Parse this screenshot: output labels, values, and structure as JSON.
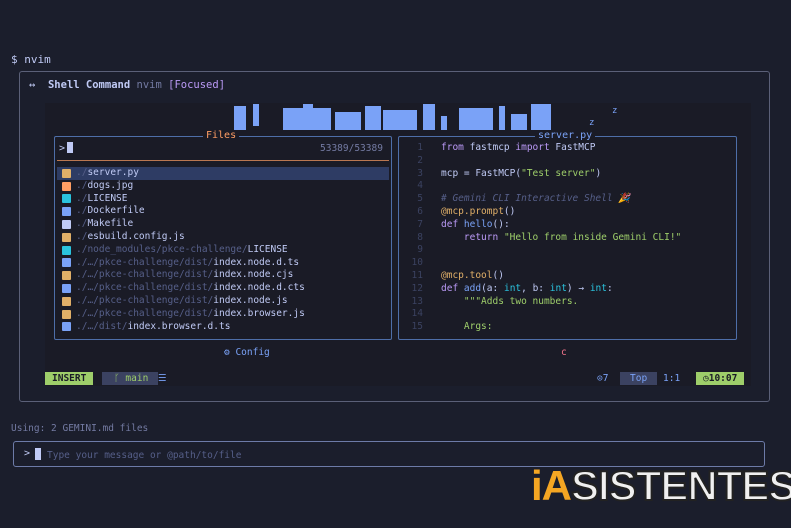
{
  "shell": {
    "prompt": "$ nvim"
  },
  "panel": {
    "arrows": "↔",
    "title": "Shell Command",
    "command": "nvim",
    "state": "[Focused]"
  },
  "logo": {
    "zz": "z z"
  },
  "files": {
    "title": "Files",
    "input_symbol": ">",
    "count": "53389/53389",
    "items": [
      {
        "dim": "./",
        "name": "server.py",
        "icon_color": "#e0af68",
        "selected": true
      },
      {
        "dim": "./",
        "name": "dogs.jpg",
        "icon_color": "#ff9e64",
        "selected": false
      },
      {
        "dim": "./",
        "name": "LICENSE",
        "icon_color": "#2ac3de",
        "selected": false
      },
      {
        "dim": "./",
        "name": "Dockerfile",
        "icon_color": "#7aa2f7",
        "selected": false
      },
      {
        "dim": "./",
        "name": "Makefile",
        "icon_color": "#c0caf5",
        "selected": false
      },
      {
        "dim": "./",
        "name": "esbuild.config.js",
        "icon_color": "#e0af68",
        "selected": false
      },
      {
        "dim": "./node_modules/pkce-challenge/",
        "name": "LICENSE",
        "icon_color": "#2ac3de",
        "selected": false
      },
      {
        "dim": "./…/pkce-challenge/dist/",
        "name": "index.node.d.ts",
        "icon_color": "#7aa2f7",
        "selected": false
      },
      {
        "dim": "./…/pkce-challenge/dist/",
        "name": "index.node.cjs",
        "icon_color": "#e0af68",
        "selected": false
      },
      {
        "dim": "./…/pkce-challenge/dist/",
        "name": "index.node.d.cts",
        "icon_color": "#7aa2f7",
        "selected": false
      },
      {
        "dim": "./…/pkce-challenge/dist/",
        "name": "index.node.js",
        "icon_color": "#e0af68",
        "selected": false
      },
      {
        "dim": "./…/pkce-challenge/dist/",
        "name": "index.browser.js",
        "icon_color": "#e0af68",
        "selected": false
      },
      {
        "dim": "./…/dist/",
        "name": "index.browser.d.ts",
        "icon_color": "#7aa2f7",
        "selected": false
      }
    ]
  },
  "editor": {
    "title": "server.py",
    "lines": [
      {
        "n": "1",
        "html": "<span class=\"kw\">from</span> fastmcp <span class=\"kw\">import</span> FastMCP"
      },
      {
        "n": "2",
        "html": ""
      },
      {
        "n": "3",
        "html": "mcp = FastMCP(<span class=\"str\">\"Test server\"</span>)"
      },
      {
        "n": "4",
        "html": ""
      },
      {
        "n": "5",
        "html": "<span class=\"cmt\"># Gemini CLI Interactive Shell 🎉</span>"
      },
      {
        "n": "6",
        "html": "<span class=\"dec\">@mcp.prompt</span>()"
      },
      {
        "n": "7",
        "html": "<span class=\"kw\">def</span> <span class=\"fn\">hello</span>():"
      },
      {
        "n": "8",
        "html": "    <span class=\"kw\">return</span> <span class=\"str\">\"Hello from inside Gemini CLI!\"</span>"
      },
      {
        "n": "9",
        "html": ""
      },
      {
        "n": "10",
        "html": ""
      },
      {
        "n": "11",
        "html": "<span class=\"dec\">@mcp.tool</span>()"
      },
      {
        "n": "12",
        "html": "<span class=\"kw\">def</span> <span class=\"fn\">add</span>(a: <span class=\"typ\">int</span>, b: <span class=\"typ\">int</span>) → <span class=\"typ\">int</span>:"
      },
      {
        "n": "13",
        "html": "    <span class=\"str\">\"\"\"Adds two numbers.</span>"
      },
      {
        "n": "14",
        "html": ""
      },
      {
        "n": "15",
        "html": "    <span class=\"str\">Args:</span>"
      }
    ]
  },
  "footer": {
    "config": "⚙ Config",
    "mark": "c"
  },
  "status": {
    "mode": "INSERT",
    "branch": " main",
    "icon": "☰",
    "diag": "⊙7",
    "position": "Top",
    "line_col": "1:1",
    "clock": "◷10:07"
  },
  "info": {
    "using": "Using: 2 GEMINI.md files"
  },
  "input": {
    "symbol": ">",
    "placeholder": "Type your message or @path/to/file"
  },
  "watermark": {
    "ia": "iA",
    "rest": "SISTENTES"
  },
  "colors": {
    "accent": "#7aa2f7",
    "insert": "#9ece6a",
    "files_title": "#ff9e64"
  }
}
